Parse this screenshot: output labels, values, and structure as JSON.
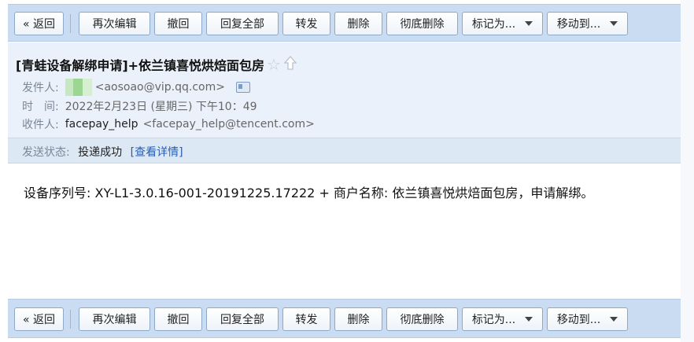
{
  "toolbar": {
    "back": "« 返回",
    "edit_again": "再次编辑",
    "recall": "撤回",
    "reply_all": "回复全部",
    "forward": "转发",
    "delete": "删除",
    "delete_permanently": "彻底删除",
    "mark_as": "标记为...",
    "move_to": "移动到..."
  },
  "email": {
    "subject": "[青蛙设备解绑申请]+依兰镇喜悦烘焙面包房",
    "star_glyph": "☆",
    "sender_label": "发件人:",
    "sender_email": "<aosoao@vip.qq.com>",
    "time_label": "时　间:",
    "time_value": "2022年2月23日 (星期三) 下午10：49",
    "recipient_label": "收件人:",
    "recipient_name": "facepay_help",
    "recipient_email": "<facepay_help@tencent.com>",
    "status_label": "发送状态:",
    "status_value": "投递成功",
    "status_link": "[查看详情]",
    "body": "设备序列号: XY-L1-3.0.16-001-20191225.17222 + 商户名称: 依兰镇喜悦烘焙面包房，申请解绑。"
  },
  "colors": {
    "toolbar_bg": "#c9dcf2",
    "header_bg": "#eaf1fa",
    "status_bg": "#dde8f5",
    "link": "#2a5db0"
  }
}
